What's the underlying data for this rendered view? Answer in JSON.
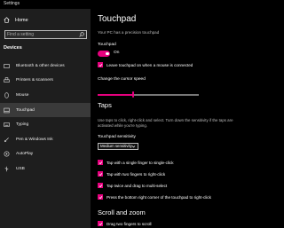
{
  "app": {
    "title": "Settings"
  },
  "sidebar": {
    "home_label": "Home",
    "search_placeholder": "Find a setting",
    "section": "Devices",
    "items": [
      {
        "label": "Bluetooth & other devices",
        "icon": "bluetooth-icon"
      },
      {
        "label": "Printers & scanners",
        "icon": "printer-icon"
      },
      {
        "label": "Mouse",
        "icon": "mouse-icon"
      },
      {
        "label": "Touchpad",
        "icon": "touchpad-icon",
        "active": true
      },
      {
        "label": "Typing",
        "icon": "keyboard-icon"
      },
      {
        "label": "Pen & Windows Ink",
        "icon": "pen-icon"
      },
      {
        "label": "AutoPlay",
        "icon": "autoplay-icon"
      },
      {
        "label": "USB",
        "icon": "usb-icon"
      }
    ]
  },
  "main": {
    "title": "Touchpad",
    "subtitle": "Your PC has a precision touchpad",
    "touchpad_label": "Touchpad",
    "toggle_state": "On",
    "leave_on_label": "Leave touchpad on when a mouse is connected",
    "cursor_speed_label": "Change the cursor speed",
    "cursor_speed_fraction": 0.35,
    "taps_heading": "Taps",
    "taps_desc": "Use taps to click, right-click and select. Turn down the sensitivity if the taps are activated while you're typing.",
    "sensitivity_label": "Touchpad sensitivity",
    "sensitivity_value": "Medium sensitivity",
    "checkboxes": [
      "Tap with a single finger to single-click",
      "Tap with two fingers to right-click",
      "Tap twice and drag to multi-select",
      "Press the bottom right corner of the touchpad to right-click"
    ],
    "scroll_heading": "Scroll and zoom",
    "drag_scroll_label": "Drag two fingers to scroll"
  },
  "colors": {
    "accent": "#e6007e",
    "background": "#000000",
    "sidebar": "#1e1e1e"
  }
}
